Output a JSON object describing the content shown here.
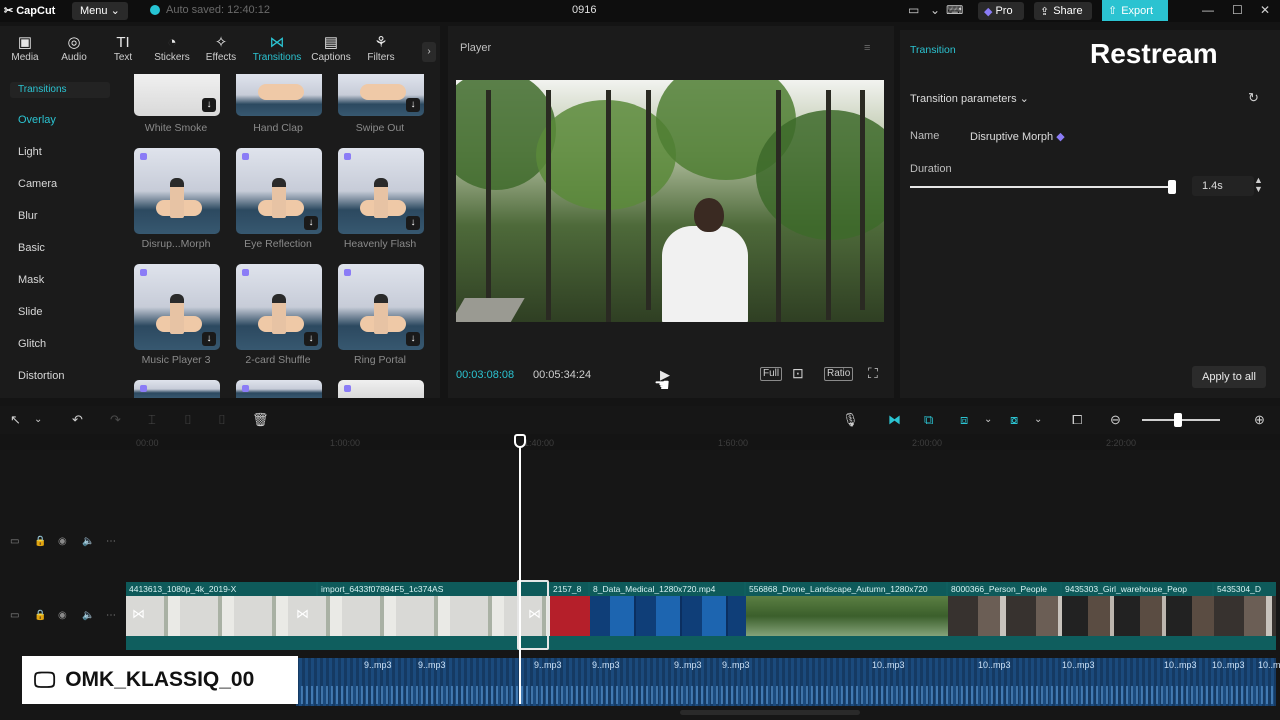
{
  "titlebar": {
    "app_name": "CapCut",
    "menu_label": "Menu ⌄",
    "project_name": "Auto saved: 12:40:12",
    "center_title": "0916",
    "pro_label": "Pro",
    "share_label": "Share",
    "export_label": "Export",
    "accent": "#2bc3d1"
  },
  "toolbar": [
    {
      "label": "Media",
      "icon": "▣"
    },
    {
      "label": "Audio",
      "icon": "◎"
    },
    {
      "label": "Text",
      "icon": "TI"
    },
    {
      "label": "Stickers",
      "icon": "◔"
    },
    {
      "label": "Effects",
      "icon": "✧"
    },
    {
      "label": "Transitions",
      "icon": "⋈"
    },
    {
      "label": "Captions",
      "icon": "▤"
    },
    {
      "label": "Filters",
      "icon": "⚘"
    }
  ],
  "categories": {
    "header": "Transitions",
    "items": [
      "Overlay",
      "Light",
      "Camera",
      "Blur",
      "Basic",
      "Mask",
      "Slide",
      "Glitch",
      "Distortion"
    ]
  },
  "grid": {
    "row0": [
      "White Smoke",
      "Hand Clap",
      "Swipe Out"
    ],
    "row1": [
      "Disrup...Morph",
      "Eye Reflection",
      "Heavenly Flash"
    ],
    "row2": [
      "Music Player 3",
      "2-card Shuffle",
      "Ring Portal"
    ]
  },
  "player": {
    "title": "Player",
    "time_current": "00:03:08:08",
    "time_total": "00:05:34:24",
    "full_label": "Full",
    "ratio_label": "Ratio"
  },
  "right": {
    "tab": "Transition",
    "overlay_text": "Restream",
    "params_label": "Transition parameters ⌄",
    "name_label": "Name",
    "name_value": "Disruptive Morph",
    "duration_label": "Duration",
    "duration_value": "1.4s",
    "apply_all": "Apply to all"
  },
  "ruler": [
    "00:00",
    "1:00:00",
    "1:40:00",
    "1:60:00",
    "2:00:00",
    "2:20:00"
  ],
  "video_clips": [
    "4413613_1080p_4k_2019-X",
    "import_6433f07894F5_1c374AS",
    "2157_8",
    "8_Data_Medical_1280x720.mp4",
    "556868_Drone_Landscape_Autumn_1280x720",
    "8000366_Person_People",
    "9435303_Girl_warehouse_Peop",
    "5435304_D"
  ],
  "audio_clips": [
    "9..mp3",
    "9..mp3",
    "9..mp3",
    "9..mp3",
    "9..mp3",
    "9..mp3",
    "10..mp3",
    "10..mp3",
    "10..mp3",
    "10..mp3",
    "10..mp3",
    "10..mp3"
  ],
  "watermark": "OMK_KLASSIQ_00"
}
